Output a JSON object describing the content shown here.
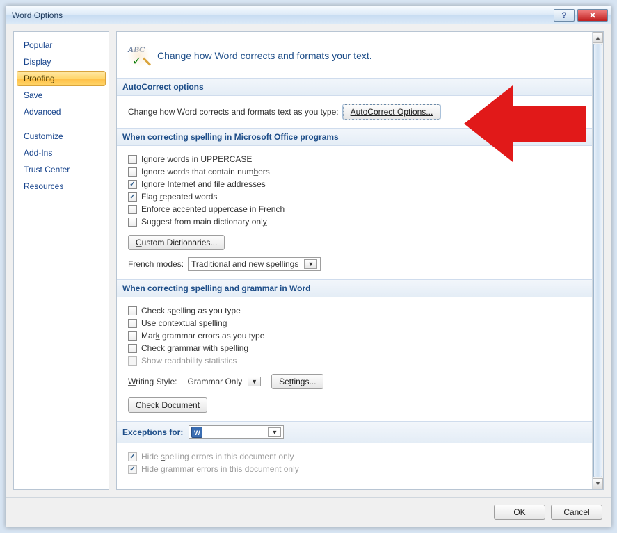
{
  "titlebar": {
    "title": "Word Options"
  },
  "heading": {
    "text": "Change how Word corrects and formats your text."
  },
  "sidebar": {
    "items": [
      "Popular",
      "Display",
      "Proofing",
      "Save",
      "Advanced",
      "Customize",
      "Add-Ins",
      "Trust Center",
      "Resources"
    ],
    "selected_index": 2
  },
  "section_autocorrect": {
    "title": "AutoCorrect options",
    "text": "Change how Word corrects and formats text as you type:",
    "button": "AutoCorrect Options..."
  },
  "section_office_spelling": {
    "title": "When correcting spelling in Microsoft Office programs",
    "checks": [
      {
        "label_pre": "Ignore words in ",
        "label_u": "U",
        "label_post": "PPERCASE",
        "checked": false
      },
      {
        "label_pre": "Ignore words that contain num",
        "label_u": "b",
        "label_post": "ers",
        "checked": false
      },
      {
        "label_pre": "Ignore Internet and ",
        "label_u": "f",
        "label_post": "ile addresses",
        "checked": true
      },
      {
        "label_pre": "Flag ",
        "label_u": "r",
        "label_post": "epeated words",
        "checked": true
      },
      {
        "label_pre": "Enforce accented uppercase in Fr",
        "label_u": "e",
        "label_post": "nch",
        "checked": false
      },
      {
        "label_pre": "Suggest from main dictionary onl",
        "label_u": "y",
        "label_post": "",
        "checked": false
      }
    ],
    "custom_dict_button": "Custom Dictionaries...",
    "french_label": "French modes:",
    "french_value": "Traditional and new spellings"
  },
  "section_word_spelling": {
    "title": "When correcting spelling and grammar in Word",
    "checks": [
      {
        "label_pre": "Check s",
        "label_u": "p",
        "label_post": "elling as you type",
        "checked": false
      },
      {
        "label_pre": "Use contextual spellin",
        "label_u": "g",
        "label_post": "",
        "checked": false
      },
      {
        "label_pre": "Mar",
        "label_u": "k",
        "label_post": " grammar errors as you type",
        "checked": false
      },
      {
        "label_pre": "Check grammar with spellin",
        "label_u": "g",
        "label_post": "",
        "checked": false
      },
      {
        "label_pre": "Show readability statistics",
        "label_u": "",
        "label_post": "",
        "checked": false,
        "disabled": true
      }
    ],
    "writing_style_label": "Writing Style:",
    "writing_style_value": "Grammar Only",
    "settings_button": "Settings...",
    "check_doc_button": "Check Document"
  },
  "section_exceptions": {
    "title": "Exceptions for:",
    "doc_value": "",
    "checks": [
      {
        "label_pre": "Hide ",
        "label_u": "s",
        "label_post": "pelling errors in this document only",
        "checked": true,
        "disabled": true
      },
      {
        "label_pre": "Hide grammar errors in this document onl",
        "label_u": "y",
        "label_post": "",
        "checked": true,
        "disabled": true
      }
    ]
  },
  "buttons": {
    "ok": "OK",
    "cancel": "Cancel"
  }
}
